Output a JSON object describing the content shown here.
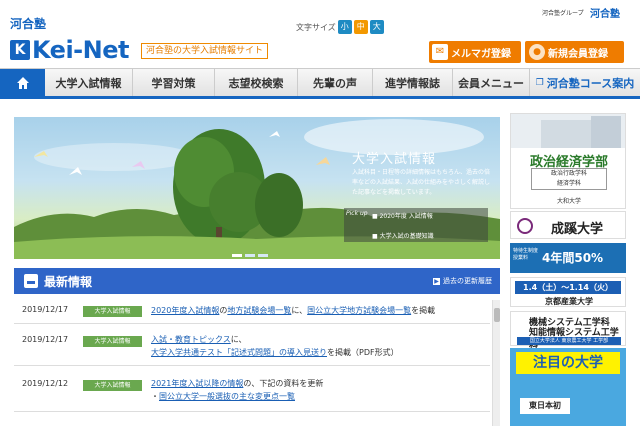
{
  "header": {
    "logo_top": "河合塾",
    "logo_k": "K",
    "logo_main": "Kei-Net",
    "tagline": "河合塾の大学入試情報サイト",
    "font_size_label": "文字サイズ",
    "font_sizes": [
      "小",
      "中",
      "大"
    ],
    "active_font_size": "中",
    "group_link": "河合塾グループ",
    "group_logo": "河合塾",
    "mail_button": "メルマガ登録",
    "member_button": "新規会員登録"
  },
  "nav": {
    "home_icon": "home-icon",
    "items": [
      "大学入試情報",
      "学習対策",
      "志望校検索",
      "先輩の声",
      "進学情報誌",
      "会員メニュー"
    ],
    "course_link": "河合塾コース案内"
  },
  "hero": {
    "title": "大学入試情報",
    "description": "入試科目・日程等の詳細情報はもちろん、過去の倍率などの入試結果、入試の仕組みをやさしく解説した記事などを掲載しています。",
    "pickup_label": "Pick up",
    "pickup_items": [
      "2020年度 入試情報",
      "大学入試の基礎知識"
    ]
  },
  "news": {
    "title": "最新情報",
    "past_link": "過去の更新履歴",
    "items": [
      {
        "date": "2019/12/17",
        "category": "大学入試情報",
        "parts": [
          {
            "t": "2020年度入試情報",
            "link": true
          },
          {
            "t": "の",
            "link": false
          },
          {
            "t": "地方試験会場一覧",
            "link": true
          },
          {
            "t": "に、",
            "link": false
          },
          {
            "t": "国公立大学地方試験会場一覧",
            "link": true
          },
          {
            "t": "を掲載",
            "link": false
          }
        ]
      },
      {
        "date": "2019/12/17",
        "category": "大学入試情報",
        "line1": [
          {
            "t": "入試・教育トピックス",
            "link": true
          },
          {
            "t": "に、",
            "link": false
          }
        ],
        "line2": [
          {
            "t": "大学入学共通テスト「記述式問題」の導入見送り",
            "link": true
          },
          {
            "t": "を掲載（PDF形式）",
            "link": false
          }
        ]
      },
      {
        "date": "2019/12/12",
        "category": "大学入試情報",
        "line1": [
          {
            "t": "2021年度入試以降の情報",
            "link": true
          },
          {
            "t": "の、下記の資料を更新",
            "link": false
          }
        ],
        "line2": [
          {
            "t": "・",
            "link": false
          },
          {
            "t": "国公立大学一般選抜の主な変更点一覧",
            "link": true
          }
        ]
      }
    ]
  },
  "ads": {
    "ad1_title": "政治経済学部",
    "ad1_sub": [
      "政治行政学科",
      "経済学科"
    ],
    "ad1_univ": "大和大学",
    "ad2_name": "成蹊大学",
    "ad3_left": [
      "特待生制度",
      "授業料"
    ],
    "ad3_main": "4年間50%",
    "ad4_date": "1.4（土）～1.14（火）",
    "ad4_univ": "京都産業大学",
    "ad5_l1": "機械システム工学科",
    "ad5_l2": "知能情報システム工学科",
    "ad5_l3": "国立大学法人 東京農工大学 工学部",
    "ad6_title": "注目の大学",
    "ad6_box": "東日本初"
  },
  "colors": {
    "brand_blue": "#1565c0",
    "news_blue": "#2f65c8",
    "orange": "#ef7c00",
    "category_green": "#6aa84f"
  }
}
